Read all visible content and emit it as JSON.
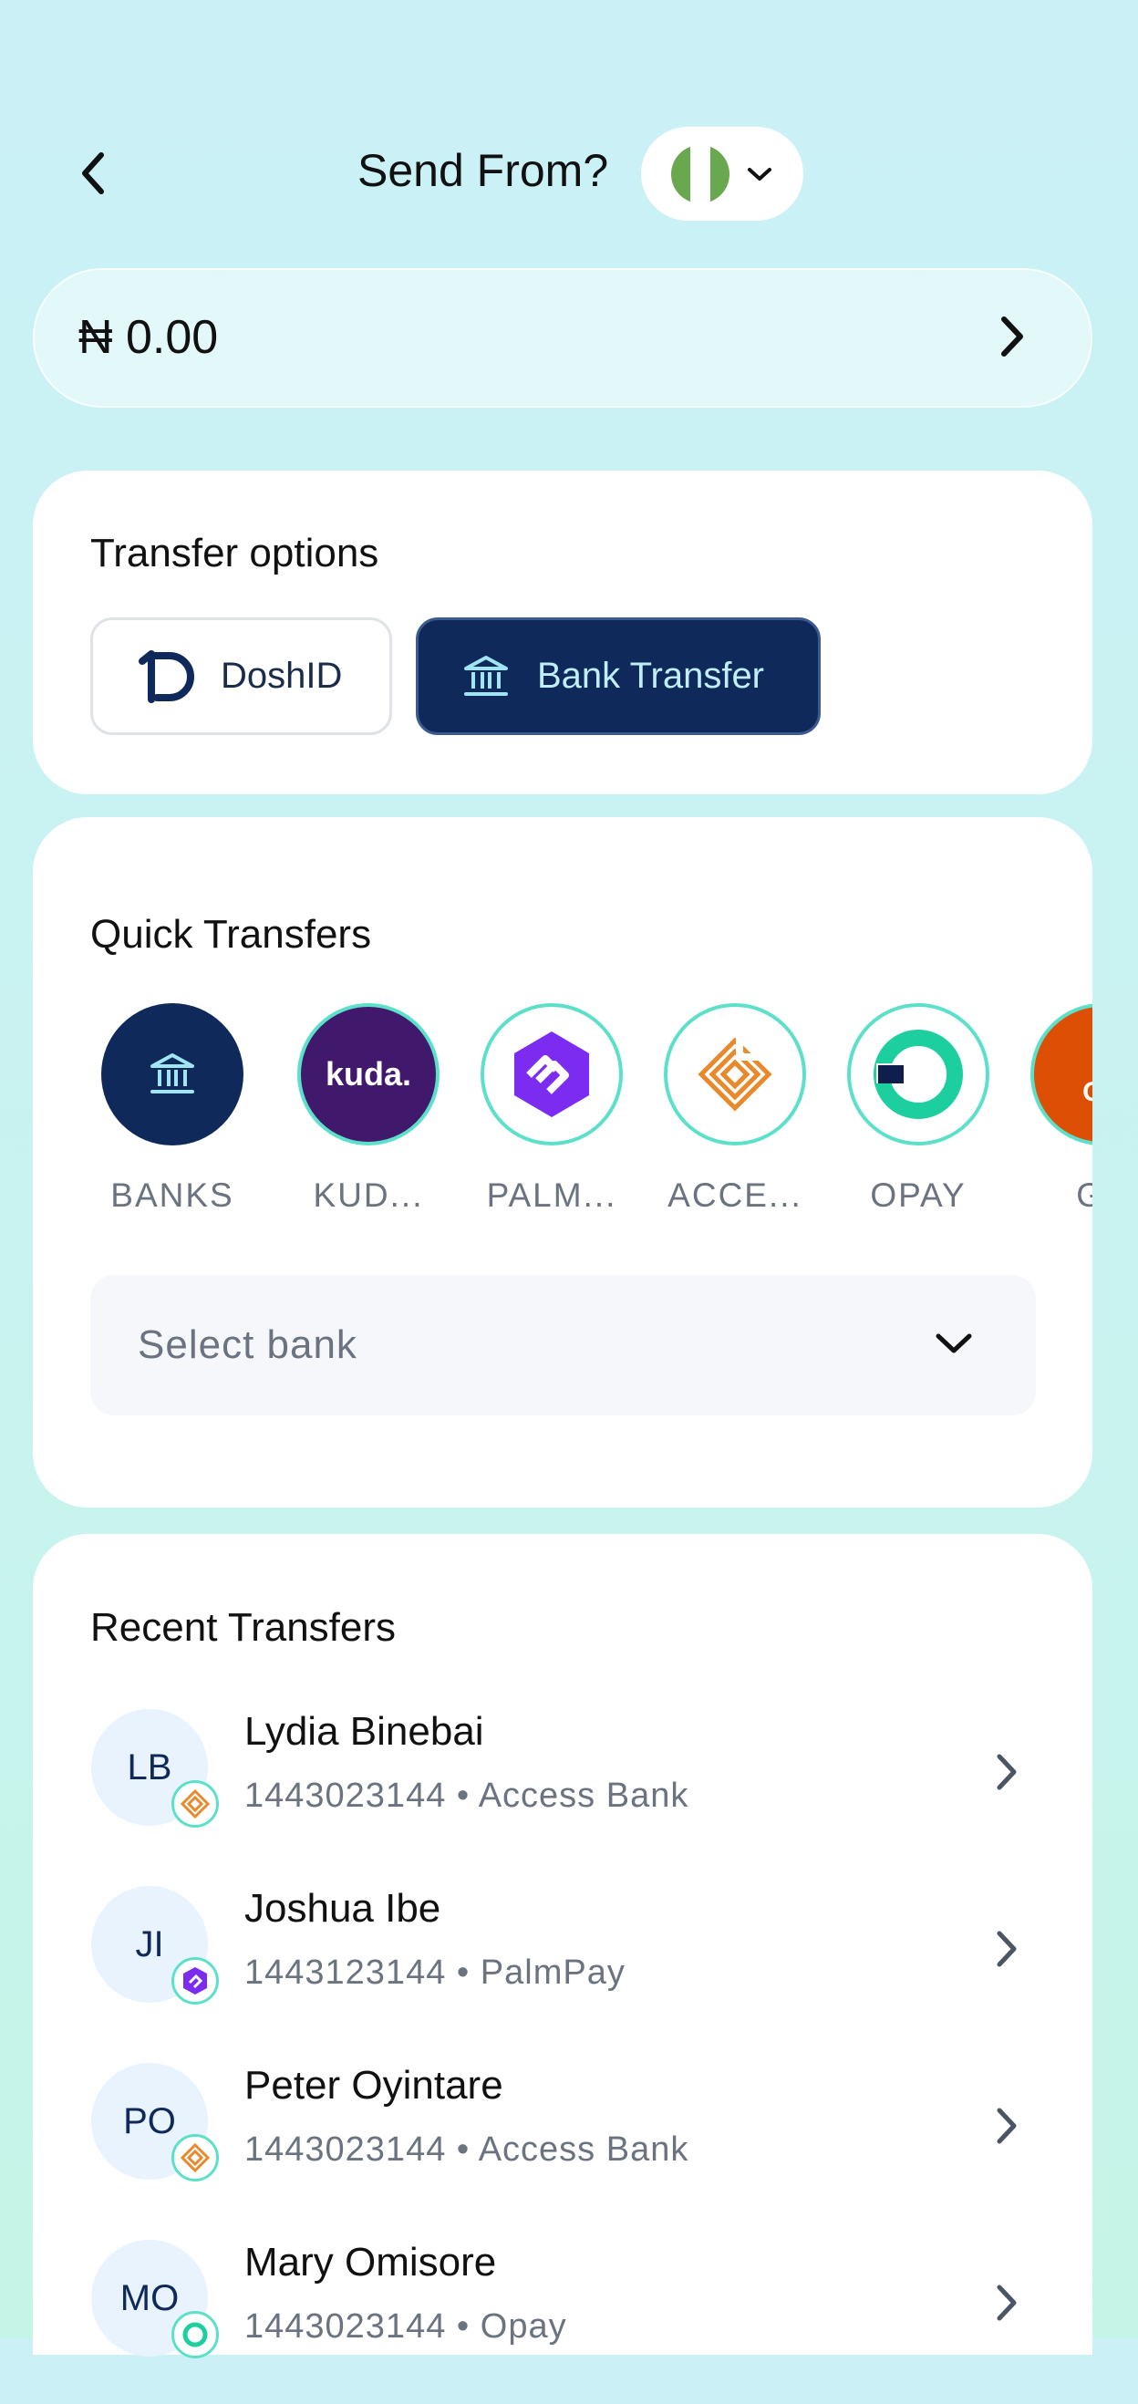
{
  "header": {
    "title": "Send From?",
    "country_flag": "nigeria-flag-icon",
    "country_dropdown_icon": "chevron-down-icon"
  },
  "balance": {
    "amount": "₦ 0.00"
  },
  "transfer_options": {
    "title": "Transfer options",
    "options": [
      {
        "label": "DoshID",
        "icon": "doshid-logo-icon",
        "selected": false
      },
      {
        "label": "Bank Transfer",
        "icon": "bank-building-icon",
        "selected": true
      }
    ]
  },
  "quick_transfers": {
    "title": "Quick Transfers",
    "items": [
      {
        "label": "BANKS",
        "icon": "bank-building-icon"
      },
      {
        "label": "KUD...",
        "icon": "kuda-logo-icon",
        "logo_text": "kuda."
      },
      {
        "label": "PALM...",
        "icon": "palmpay-logo-icon"
      },
      {
        "label": "ACCE...",
        "icon": "access-bank-logo-icon"
      },
      {
        "label": "OPAY",
        "icon": "opay-logo-icon"
      },
      {
        "label": "GT",
        "icon": "gtbank-logo-icon",
        "logo_text": "GT"
      }
    ],
    "select_bank": {
      "placeholder": "Select bank"
    }
  },
  "recent_transfers": {
    "title": "Recent Transfers",
    "items": [
      {
        "initials": "LB",
        "name": "Lydia Binebai",
        "account": "1443023144",
        "separator": "•",
        "bank": "Access Bank",
        "bank_icon": "access-bank-logo-icon"
      },
      {
        "initials": "JI",
        "name": "Joshua Ibe",
        "account": "1443123144",
        "separator": "•",
        "bank": "PalmPay",
        "bank_icon": "palmpay-logo-icon"
      },
      {
        "initials": "PO",
        "name": "Peter Oyintare",
        "account": "1443023144",
        "separator": "•",
        "bank": "Access Bank",
        "bank_icon": "access-bank-logo-icon"
      },
      {
        "initials": "MO",
        "name": "Mary Omisore",
        "account": "1443023144",
        "separator": "•",
        "bank": "Opay",
        "bank_icon": "opay-logo-icon"
      }
    ]
  },
  "colors": {
    "primary_navy": "#0f2a5a",
    "accent_teal": "#5de0c9",
    "kuda_purple": "#40196d",
    "palmpay_purple": "#7b2cf0",
    "access_orange": "#e8892b",
    "opay_green": "#1dcf9f",
    "gtbank_orange": "#dd4f05"
  }
}
